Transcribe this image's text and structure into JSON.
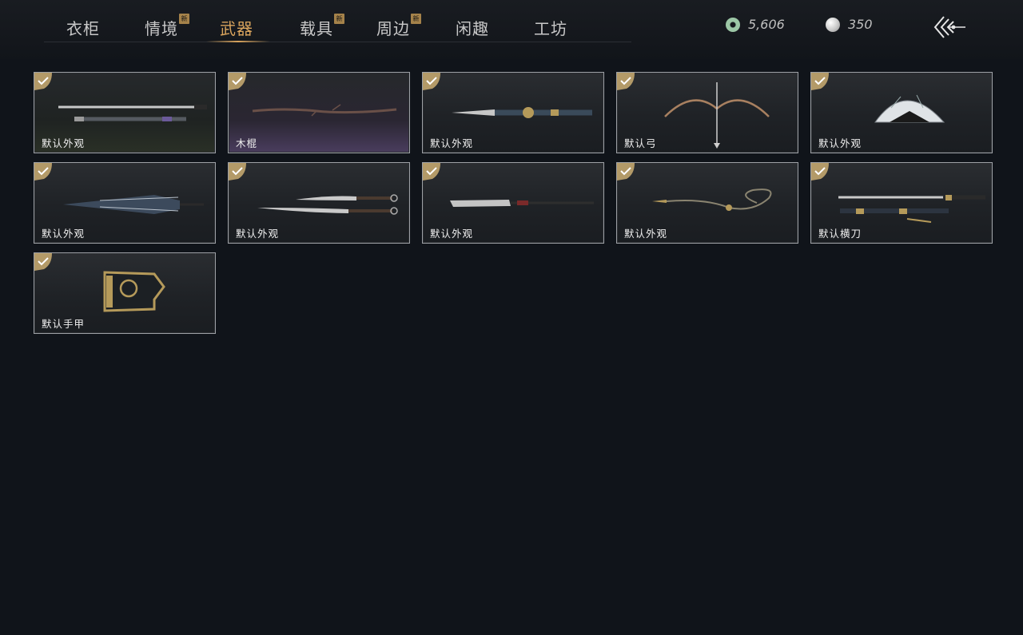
{
  "tabs": [
    {
      "label": "衣柜",
      "new": false
    },
    {
      "label": "情境",
      "new": true
    },
    {
      "label": "武器",
      "new": false,
      "active": true
    },
    {
      "label": "载具",
      "new": true
    },
    {
      "label": "周边",
      "new": true
    },
    {
      "label": "闲趣",
      "new": false
    },
    {
      "label": "工坊",
      "new": false
    }
  ],
  "new_badge": "新",
  "currency": {
    "jade": "5,606",
    "pearl": "350"
  },
  "icons": {
    "jade": "jade-coin-icon",
    "pearl": "pearl-icon",
    "back": "back-arrow-icon",
    "check": "check-icon"
  },
  "colors": {
    "accent": "#d9a45d",
    "background": "#10141a",
    "card_border": "#9da0a5",
    "check_badge": "#b39a68"
  },
  "items": [
    {
      "label": "默认外观",
      "art": "sword"
    },
    {
      "label": "木棍",
      "art": "stick"
    },
    {
      "label": "默认外观",
      "art": "spear-blade"
    },
    {
      "label": "默认弓",
      "art": "bow"
    },
    {
      "label": "默认外观",
      "art": "fan"
    },
    {
      "label": "默认外观",
      "art": "umbrella"
    },
    {
      "label": "默认外观",
      "art": "twin-sabres"
    },
    {
      "label": "默认外观",
      "art": "glaive"
    },
    {
      "label": "默认外观",
      "art": "rope-dart"
    },
    {
      "label": "默认横刀",
      "art": "hengdao"
    },
    {
      "label": "默认手甲",
      "art": "gauntlet"
    }
  ]
}
